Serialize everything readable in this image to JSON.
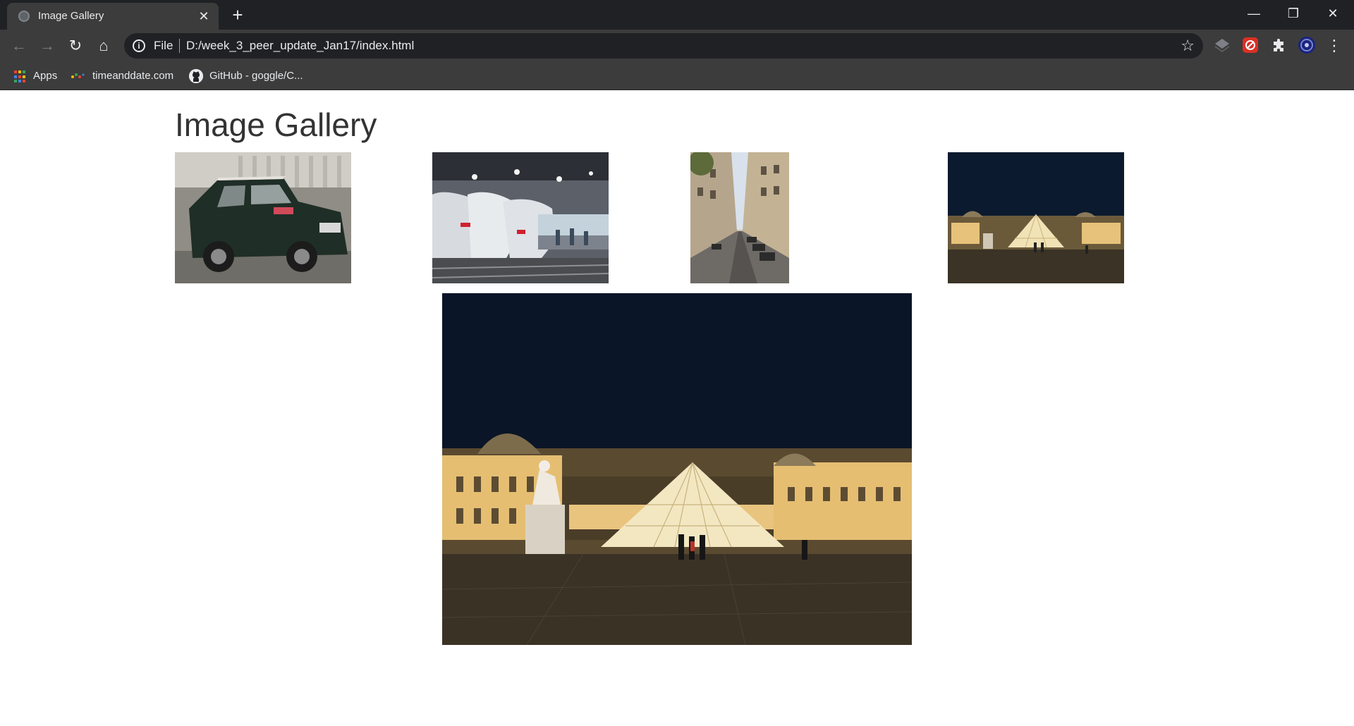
{
  "browser": {
    "tab_title": "Image Gallery",
    "tab_close": "✕",
    "new_tab": "+",
    "window_controls": {
      "minimize": "—",
      "restore": "❐",
      "close": "✕"
    },
    "nav": {
      "back": "←",
      "forward": "→",
      "reload": "↻",
      "home": "⌂"
    },
    "address": {
      "scheme": "File",
      "url": "D:/week_3_peer_update_Jan17/index.html",
      "info_icon": "i",
      "star": "☆"
    },
    "menu": "⋮",
    "bookmarks": [
      {
        "label": "Apps",
        "icon": "apps-grid-icon"
      },
      {
        "label": "timeanddate.com",
        "icon": "timeanddate-icon"
      },
      {
        "label": "GitHub - goggle/C...",
        "icon": "github-icon"
      }
    ]
  },
  "page": {
    "title": "Image Gallery",
    "thumbnails": [
      {
        "name": "mini-cooper",
        "subject": "green mini car parked on street"
      },
      {
        "name": "tgv-trains",
        "subject": "high speed trains at station"
      },
      {
        "name": "paris-street",
        "subject": "narrow street with buildings"
      },
      {
        "name": "louvre-night",
        "subject": "louvre pyramid at night"
      }
    ],
    "featured": {
      "name": "louvre-night-large",
      "subject": "louvre pyramid at night"
    }
  },
  "colors": {
    "tabstrip": "#202124",
    "toolbar": "#3c3c3c",
    "omnibox": "#202124",
    "text_light": "#e8eaed",
    "page_title": "#333333"
  }
}
